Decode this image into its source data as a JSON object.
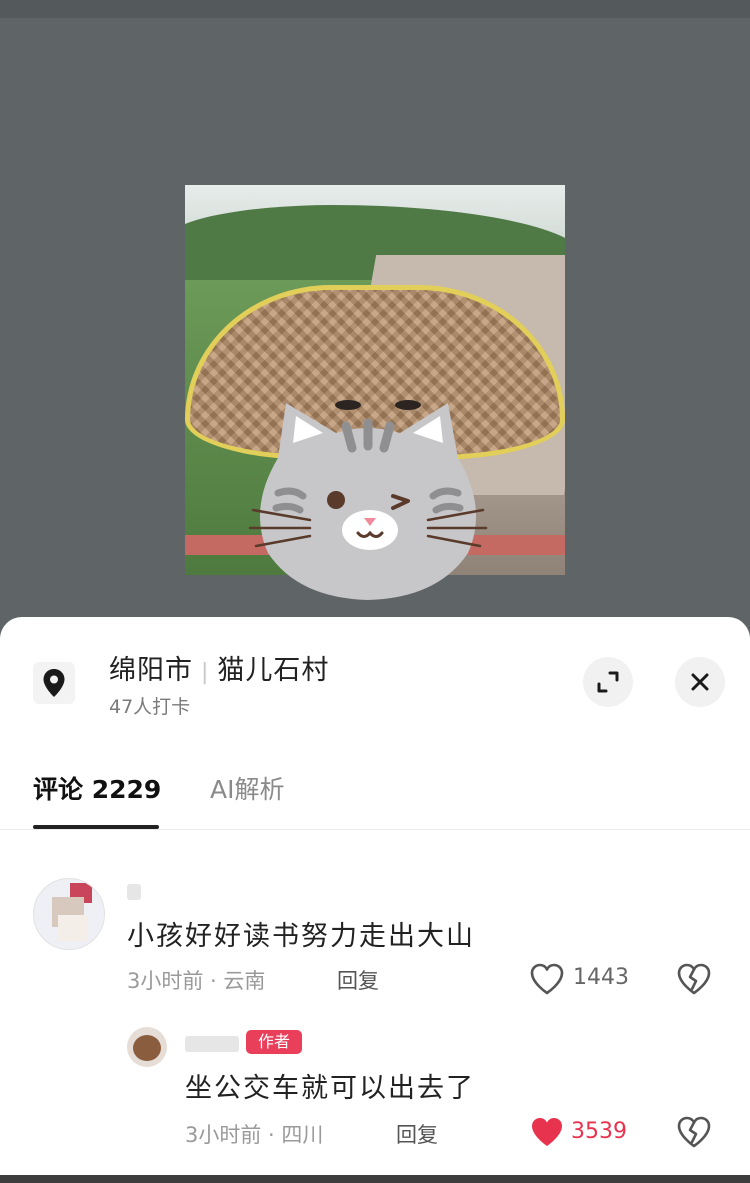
{
  "location": {
    "city": "绵阳市",
    "village": "猫儿石村",
    "separator": "|",
    "checkins": "47人打卡"
  },
  "tabs": [
    {
      "label": "评论 2229",
      "active": true
    },
    {
      "label": "AI解析",
      "active": false
    }
  ],
  "comments": [
    {
      "text": "小孩好好读书努力走出大山",
      "meta": "3小时前 · 云南",
      "reply_label": "回复",
      "likes": "1443",
      "liked": false
    }
  ],
  "replies": [
    {
      "badge": "作者",
      "text": "坐公交车就可以出去了",
      "meta": "3小时前 · 四川",
      "reply_label": "回复",
      "likes": "3539",
      "liked": true
    }
  ],
  "icons": {
    "location": "location-pin-icon",
    "expand": "expand-icon",
    "close": "close-icon",
    "like": "heart-icon",
    "dislike": "broken-heart-icon"
  },
  "colors": {
    "accent_like": "#e8334f",
    "badge": "#ea3f5b",
    "backdrop": "#5f6467"
  }
}
